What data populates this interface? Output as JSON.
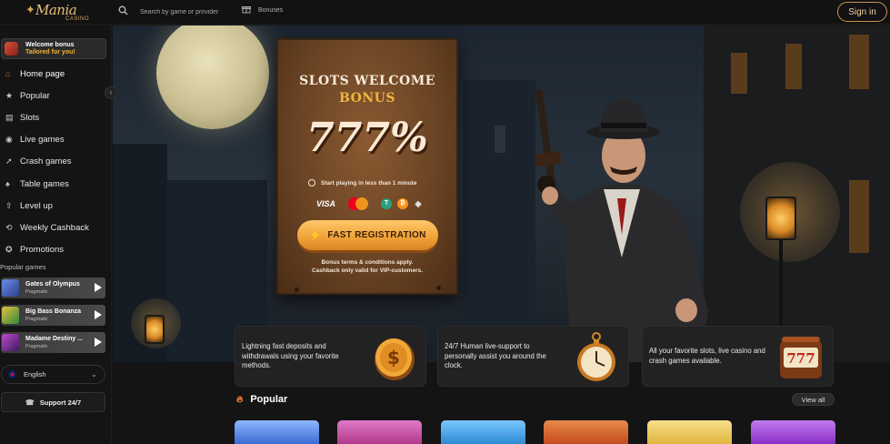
{
  "header": {
    "logo": {
      "name": "Mania",
      "sub": "CASINO"
    },
    "search_placeholder": "Search by game or provider",
    "bonuses_label": "Bonuses",
    "signin_label": "Sign in"
  },
  "sidebar": {
    "welcome": {
      "title": "Welcome bonus",
      "subtitle": "Tailored for you!"
    },
    "items": [
      {
        "label": "Home page",
        "icon": "home-icon"
      },
      {
        "label": "Popular",
        "icon": "star-icon"
      },
      {
        "label": "Slots",
        "icon": "slot-machine-icon"
      },
      {
        "label": "Live games",
        "icon": "live-icon"
      },
      {
        "label": "Crash games",
        "icon": "rocket-icon"
      },
      {
        "label": "Table games",
        "icon": "cards-icon"
      },
      {
        "label": "Level up",
        "icon": "level-up-icon"
      },
      {
        "label": "Weekly Cashback",
        "icon": "cashback-icon"
      },
      {
        "label": "Promotions",
        "icon": "promotions-icon"
      }
    ],
    "popular_title": "Popular games",
    "popular_games": [
      {
        "name": "Gates of Olympus",
        "provider": "Pragmatic",
        "color": "#3b5fc4"
      },
      {
        "name": "Big Bass Bonanza",
        "provider": "Pragmatic",
        "color": "#2f8a3a"
      },
      {
        "name": "Madame Destiny ...",
        "provider": "Pragmatic",
        "color": "#7a2d8a"
      }
    ],
    "language": "English",
    "support_label": "Support 24/7"
  },
  "hero": {
    "line1": "SLOTS WELCOME",
    "line2": "BONUS",
    "percent": "777%",
    "clock_text": "Start playing in less than 1 minute",
    "payments": {
      "visa": "VISA",
      "mastercard_label": "mastercard"
    },
    "cta_label": "FAST REGISTRATION",
    "terms_line1": "Bonus terms & conditions apply.",
    "terms_line2": "Cashback only valid for VIP-customers."
  },
  "features": [
    {
      "text": "Lightning fast deposits and withdrawals using your favorite methods.",
      "icon": "coin-icon"
    },
    {
      "text": "24/7 Human live-support to personally assist you around the clock.",
      "icon": "pocket-watch-icon"
    },
    {
      "text": "All your favorite slots, live casino and crash games available.",
      "icon": "slot-777-icon"
    }
  ],
  "popular": {
    "title": "Popular",
    "view_all": "View all",
    "tiles": [
      "#3a6bd1",
      "#b23a8a",
      "#2e8bd4",
      "#c44a1e",
      "#e0b640",
      "#8a2fc4"
    ]
  },
  "colors": {
    "accent": "#f1a43a",
    "brand_gold": "#e8c07a",
    "background": "#141414"
  }
}
